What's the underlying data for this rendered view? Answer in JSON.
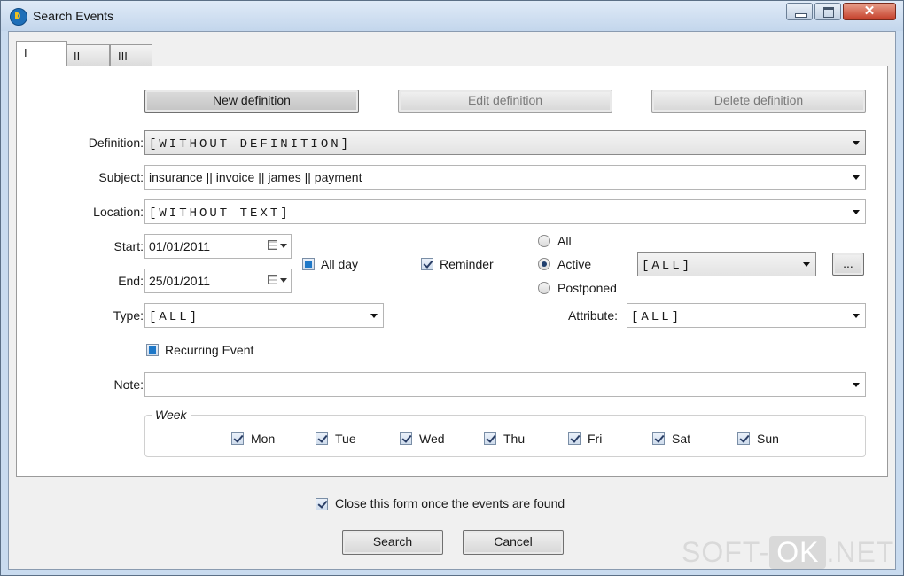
{
  "window": {
    "title": "Search Events",
    "close_glyph": "✕"
  },
  "tabs": [
    "I",
    "II",
    "III"
  ],
  "toolbar": {
    "new": "New definition",
    "edit": "Edit definition",
    "delete": "Delete definition"
  },
  "fields": {
    "definition_label": "Definition:",
    "definition_value": "[WITHOUT DEFINITION]",
    "subject_label": "Subject:",
    "subject_value": "insurance || invoice || james || payment",
    "location_label": "Location:",
    "location_value": "[WITHOUT TEXT]",
    "start_label": "Start:",
    "start_value": "01/01/2011",
    "end_label": "End:",
    "end_value": "25/01/2011",
    "allday_label": "All day",
    "reminder_label": "Reminder",
    "status_options": [
      "All",
      "Active",
      "Postponed"
    ],
    "status_selected": "Active",
    "status_combo": "[ALL]",
    "more_button": "...",
    "type_label": "Type:",
    "type_value": "[ALL]",
    "attribute_label": "Attribute:",
    "attribute_value": "[ALL]",
    "recurring_label": "Recurring Event",
    "note_label": "Note:",
    "note_value": ""
  },
  "week": {
    "legend": "Week",
    "days": [
      "Mon",
      "Tue",
      "Wed",
      "Thu",
      "Fri",
      "Sat",
      "Sun"
    ]
  },
  "footer": {
    "close_form_label": "Close this form once the events are found",
    "search": "Search",
    "cancel": "Cancel"
  },
  "watermark": {
    "left": "SOFT-",
    "mid": "OK",
    "right": ".NET"
  }
}
